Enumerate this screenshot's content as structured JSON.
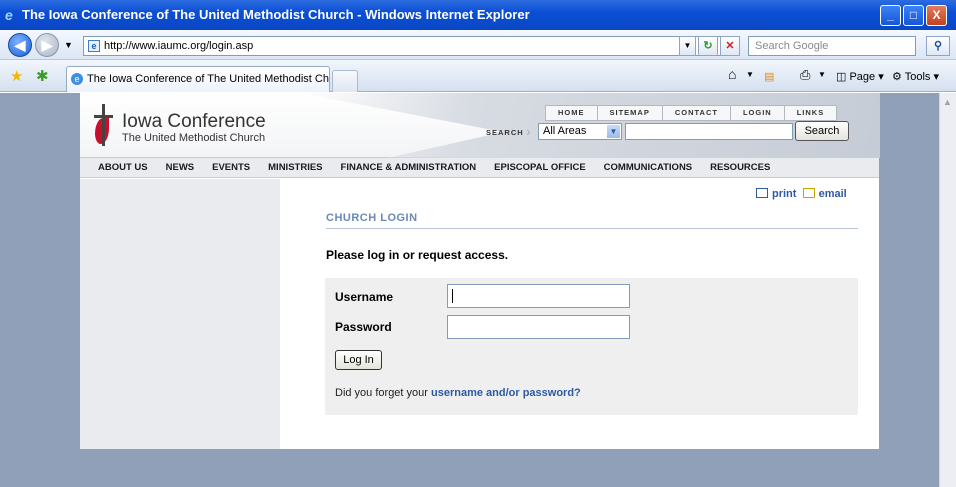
{
  "window": {
    "title": "The Iowa Conference of The United Methodist Church - Windows Internet Explorer",
    "min": "_",
    "max": "□",
    "close": "X"
  },
  "browser": {
    "url": "http://www.iaumc.org/login.asp",
    "search_placeholder": "Search Google",
    "tab_title": "The Iowa Conference of The United Methodist Church",
    "page_menu": "Page",
    "tools_menu": "Tools"
  },
  "site": {
    "org_name": "Iowa Conference",
    "org_subtitle": "The United Methodist Church",
    "top_links": [
      "HOME",
      "SITEMAP",
      "CONTACT",
      "LOGIN",
      "LINKS"
    ],
    "search_label": "SEARCH",
    "search_scope": "All Areas",
    "search_button": "Search",
    "main_nav": [
      "ABOUT US",
      "NEWS",
      "EVENTS",
      "MINISTRIES",
      "FINANCE & ADMINISTRATION",
      "EPISCOPAL OFFICE",
      "COMMUNICATIONS",
      "RESOURCES"
    ]
  },
  "page": {
    "print_label": "print",
    "email_label": "email",
    "title": "CHURCH LOGIN",
    "intro": "Please log in or request access.",
    "username_label": "Username",
    "password_label": "Password",
    "username_value": "",
    "password_value": "",
    "login_button": "Log In",
    "forgot_text": "Did you forget your",
    "forgot_link": "username and/or password?"
  }
}
